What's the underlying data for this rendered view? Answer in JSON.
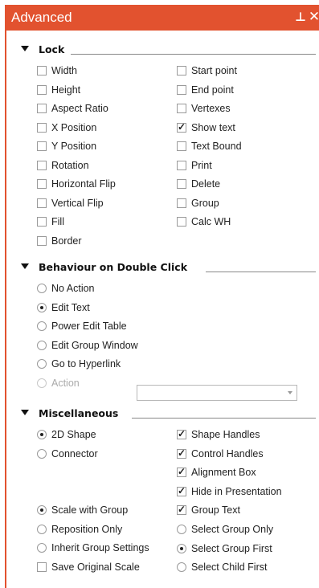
{
  "panel": {
    "title": "Advanced",
    "pin_icon": "pin-icon",
    "close_icon": "close-icon"
  },
  "lock": {
    "heading": "Lock",
    "left": [
      {
        "label": "Width",
        "checked": false
      },
      {
        "label": "Height",
        "checked": false
      },
      {
        "label": "Aspect Ratio",
        "checked": false
      },
      {
        "label": "X Position",
        "checked": false
      },
      {
        "label": "Y Position",
        "checked": false
      },
      {
        "label": "Rotation",
        "checked": false
      },
      {
        "label": "Horizontal Flip",
        "checked": false
      },
      {
        "label": "Vertical Flip",
        "checked": false
      },
      {
        "label": "Fill",
        "checked": false
      },
      {
        "label": "Border",
        "checked": false
      }
    ],
    "right": [
      {
        "label": "Start point",
        "checked": false
      },
      {
        "label": "End point",
        "checked": false
      },
      {
        "label": "Vertexes",
        "checked": false
      },
      {
        "label": "Show text",
        "checked": true
      },
      {
        "label": "Text Bound",
        "checked": false
      },
      {
        "label": "Print",
        "checked": false
      },
      {
        "label": "Delete",
        "checked": false
      },
      {
        "label": "Group",
        "checked": false
      },
      {
        "label": "Calc WH",
        "checked": false
      }
    ]
  },
  "double_click": {
    "heading": "Behaviour on Double Click",
    "options": [
      {
        "label": "No Action",
        "selected": false,
        "disabled": false
      },
      {
        "label": "Edit Text",
        "selected": true,
        "disabled": false
      },
      {
        "label": "Power Edit Table",
        "selected": false,
        "disabled": false
      },
      {
        "label": "Edit Group Window",
        "selected": false,
        "disabled": false
      },
      {
        "label": "Go to Hyperlink",
        "selected": false,
        "disabled": false
      },
      {
        "label": "Action",
        "selected": false,
        "disabled": true
      }
    ],
    "action_value": ""
  },
  "misc": {
    "heading": "Miscellaneous",
    "shape_type": [
      {
        "label": "2D Shape",
        "selected": true
      },
      {
        "label": "Connector",
        "selected": false
      }
    ],
    "group_behaviour": [
      {
        "label": "Scale with Group",
        "selected": true
      },
      {
        "label": "Reposition Only",
        "selected": false
      },
      {
        "label": "Inherit Group Settings",
        "selected": false
      }
    ],
    "save_original_scale": {
      "label": "Save Original Scale",
      "checked": false
    },
    "right_checks": [
      {
        "label": "Shape Handles",
        "checked": true
      },
      {
        "label": "Control Handles",
        "checked": true
      },
      {
        "label": "Alignment Box",
        "checked": true
      },
      {
        "label": "Hide in Presentation",
        "checked": true
      },
      {
        "label": "Group Text",
        "checked": true
      }
    ],
    "group_select": [
      {
        "label": "Select Group Only",
        "selected": false
      },
      {
        "label": "Select Group First",
        "selected": true
      },
      {
        "label": "Select Child First",
        "selected": false
      }
    ]
  }
}
